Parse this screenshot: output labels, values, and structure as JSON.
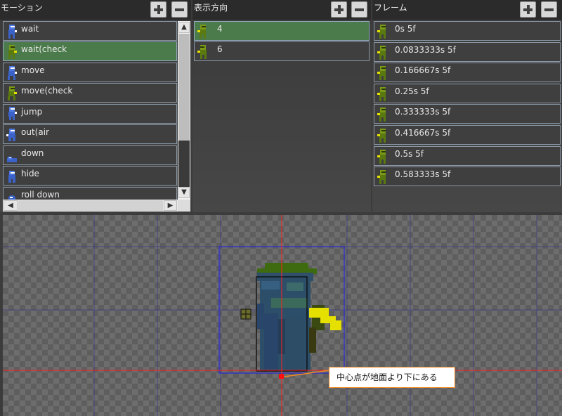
{
  "motion_panel": {
    "title": "モーション",
    "add_label": "+",
    "remove_label": "−",
    "items": [
      {
        "label": "wait",
        "color": "blue"
      },
      {
        "label": "wait(check",
        "color": "green",
        "selected": true
      },
      {
        "label": "move",
        "color": "blue"
      },
      {
        "label": "move(check",
        "color": "green"
      },
      {
        "label": "jump",
        "color": "blue"
      },
      {
        "label": "out(air",
        "color": "blue"
      },
      {
        "label": "down",
        "color": "blue"
      },
      {
        "label": "hide",
        "color": "blue"
      },
      {
        "label": "roll down",
        "color": "blue"
      }
    ]
  },
  "direction_panel": {
    "title": "表示方向",
    "items": [
      {
        "label": "4",
        "selected": true
      },
      {
        "label": "6"
      }
    ]
  },
  "frame_panel": {
    "title": "フレーム",
    "items": [
      {
        "label": "0s 5f"
      },
      {
        "label": "0.0833333s 5f"
      },
      {
        "label": "0.166667s 5f"
      },
      {
        "label": "0.25s 5f"
      },
      {
        "label": "0.333333s 5f"
      },
      {
        "label": "0.416667s 5f"
      },
      {
        "label": "0.5s 5f"
      },
      {
        "label": "0.583333s 5f"
      }
    ]
  },
  "stage": {
    "tooltip": "中心点が地面より下にある",
    "axis_color": "#ff2020",
    "bound_color": "#2a2ad8"
  },
  "colors": {
    "selected_row": "#4b7a4b",
    "row": "#3f3f3f",
    "row_border": "#8a97a4"
  }
}
